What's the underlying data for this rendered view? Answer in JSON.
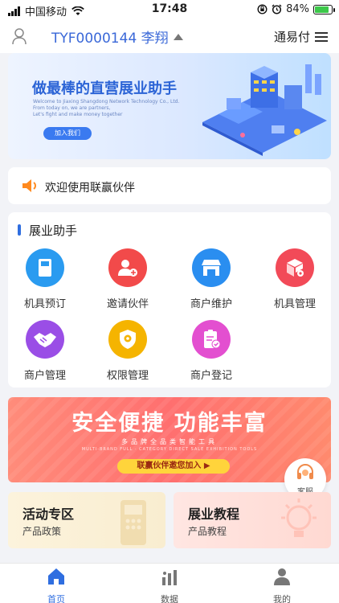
{
  "status": {
    "carrier": "中国移动",
    "time": "17:48",
    "battery": "84%",
    "battery_level": 0.84
  },
  "header": {
    "account": "TYF0000144 李翔",
    "brand": "通易付"
  },
  "banner": {
    "title": "做最棒的直营展业助手",
    "subtitle_line1": "Welcome to Jiaxing Shangdong Network Technology Co., Ltd.",
    "subtitle_line2": "From today on, we are partners,",
    "subtitle_line3": "Let's fight and make money together",
    "button": "加入我们"
  },
  "notice": {
    "text": "欢迎使用联赢伙伴"
  },
  "tools": {
    "title": "展业助手",
    "items": [
      {
        "label": "机具预订",
        "icon": "device-order-icon",
        "color": "#2a9bf0"
      },
      {
        "label": "邀请伙伴",
        "icon": "invite-partner-icon",
        "color": "#f24a4a"
      },
      {
        "label": "商户维护",
        "icon": "store-maintain-icon",
        "color": "#2a8ef0"
      },
      {
        "label": "机具管理",
        "icon": "device-manage-icon",
        "color": "#f24a58"
      },
      {
        "label": "商户管理",
        "icon": "handshake-icon",
        "color": "#9a4ee6"
      },
      {
        "label": "权限管理",
        "icon": "permission-shield-icon",
        "color": "#f5b400"
      },
      {
        "label": "商户登记",
        "icon": "register-form-icon",
        "color": "#e34fd0"
      }
    ]
  },
  "promo": {
    "title": "安全便捷 功能丰富",
    "subtitle": "多品牌全品类智能工具",
    "subtitle_en": "MULTI-BRAND FULL · CATEGORY DIRECT SALE EXHIBITION TOOLS",
    "button": "联赢伙伴邀您加入 ▶"
  },
  "service": {
    "label": "客服"
  },
  "cards": [
    {
      "title": "活动专区",
      "sub": "产品政策"
    },
    {
      "title": "展业教程",
      "sub": "产品教程"
    }
  ],
  "tabbar": {
    "items": [
      {
        "label": "首页",
        "active": true
      },
      {
        "label": "数据",
        "active": false
      },
      {
        "label": "我的",
        "active": false
      }
    ]
  }
}
